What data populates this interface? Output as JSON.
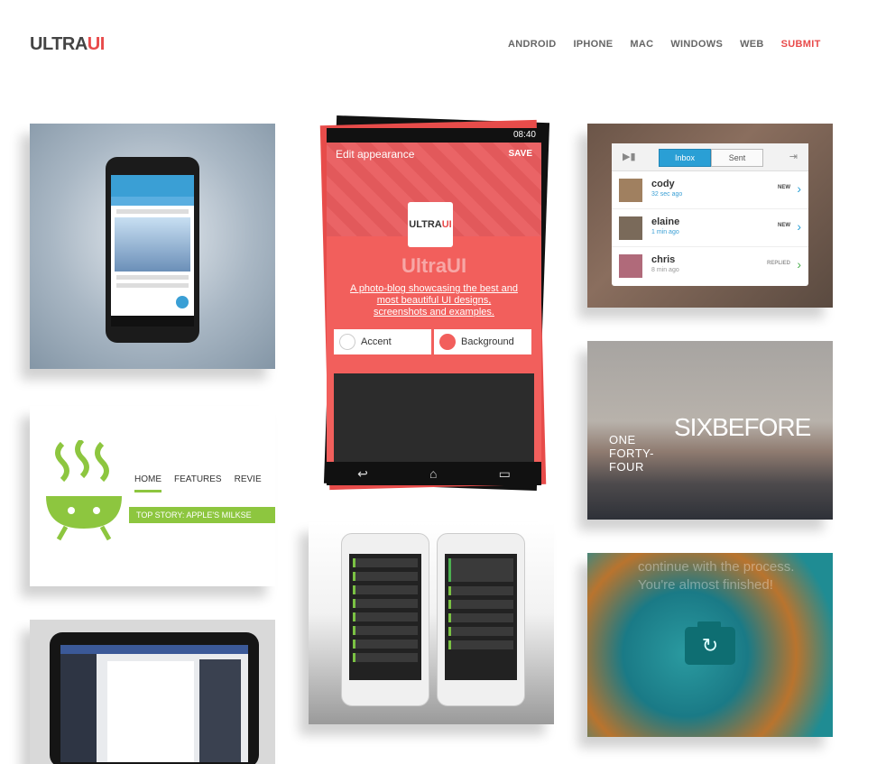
{
  "brand": {
    "prefix": "ULTRA",
    "accent": "UI",
    "accent_color": "#e84a4a"
  },
  "nav": [
    "ANDROID",
    "IPHONE",
    "MAC",
    "WINDOWS",
    "WEB",
    "SUBMIT"
  ],
  "tiles": {
    "appearance": {
      "status_time": "08:40",
      "title": "Edit appearance",
      "save": "SAVE",
      "badge_prefix": "ULTRA",
      "badge_accent": "UI",
      "name": "UltraUI",
      "description": "A photo-blog showcasing the best and most beautiful UI designs, screenshots and examples.",
      "accent_label": "Accent",
      "background_label": "Background"
    },
    "messages": {
      "tabs": [
        "Inbox",
        "Sent"
      ],
      "items": [
        {
          "name": "cody",
          "time": "32 sec ago",
          "status": "NEW"
        },
        {
          "name": "elaine",
          "time": "1 min ago",
          "status": "NEW"
        },
        {
          "name": "chris",
          "time": "8 min ago",
          "status": "REPLIED"
        }
      ]
    },
    "android_blog": {
      "menu": [
        "HOME",
        "FEATURES",
        "REVIE"
      ],
      "story": "TOP STORY: APPLE'S MILKSE"
    },
    "six_before": {
      "big": "SIXBEFORE",
      "small": "ONE FORTY-FOUR"
    },
    "camera": {
      "line1": "continue with the process.",
      "line2": "You're almost finished!"
    }
  }
}
